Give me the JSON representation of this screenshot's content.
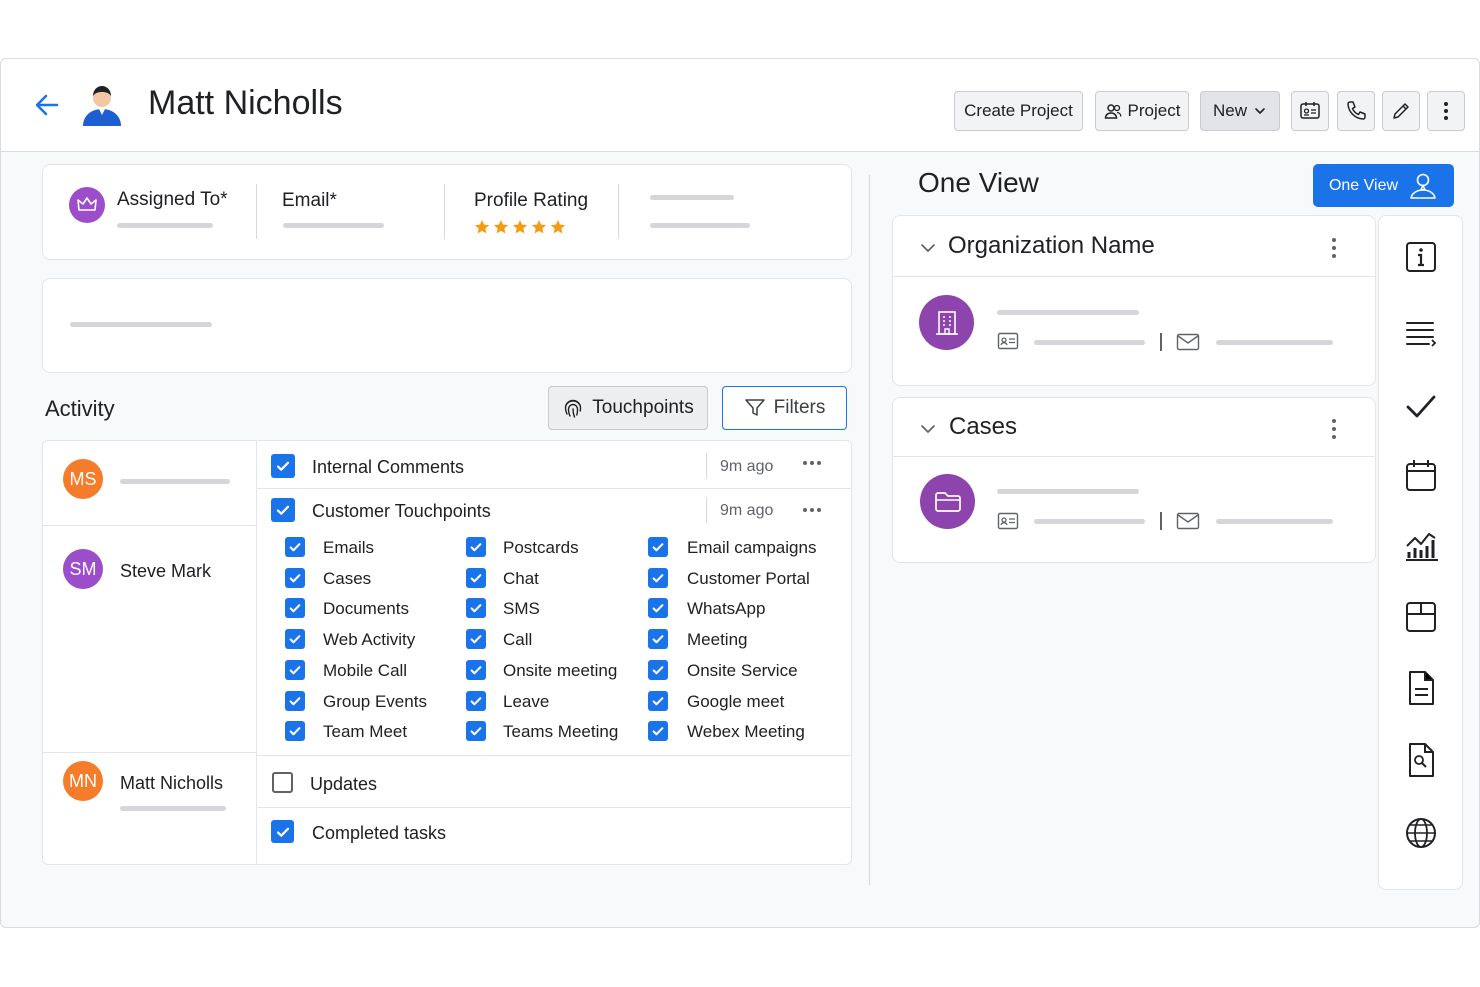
{
  "header": {
    "title": "Matt Nicholls",
    "back_icon": "arrow-left-icon",
    "user_icon": "user-avatar-icon",
    "buttons": {
      "create_project": "Create Project",
      "project": "Project",
      "new": "New"
    },
    "icon_buttons": [
      "id-card-icon",
      "phone-icon",
      "pencil-icon",
      "more-vertical-icon"
    ]
  },
  "summary": {
    "assigned_to_label": "Assigned To*",
    "email_label": "Email*",
    "profile_rating_label": "Profile Rating",
    "rating_stars": 5,
    "rating_max": 5
  },
  "activity": {
    "title": "Activity",
    "touchpoints_label": "Touchpoints",
    "filters_label": "Filters",
    "people": [
      {
        "initials": "MS",
        "name": "",
        "color": "#f57c2a"
      },
      {
        "initials": "SM",
        "name": "Steve Mark",
        "color": "#9b4dca"
      },
      {
        "initials": "MN",
        "name": "Matt Nicholls",
        "color": "#f57c2a"
      }
    ],
    "internal_comments": {
      "label": "Internal Comments",
      "time": "9m ago",
      "checked": true
    },
    "customer_touchpoints": {
      "label": "Customer Touchpoints",
      "time": "9m ago",
      "checked": true
    },
    "touchpoint_types": [
      [
        "Emails",
        "Postcards",
        "Email campaigns"
      ],
      [
        "Cases",
        "Chat",
        "Customer Portal"
      ],
      [
        "Documents",
        "SMS",
        "WhatsApp"
      ],
      [
        "Web Activity",
        "Call",
        "Meeting"
      ],
      [
        "Mobile Call",
        "Onsite meeting",
        "Onsite Service"
      ],
      [
        "Group Events",
        "Leave",
        "Google meet"
      ],
      [
        "Team Meet",
        "Teams Meeting",
        "Webex Meeting"
      ]
    ],
    "updates": {
      "label": "Updates",
      "checked": false
    },
    "completed_tasks": {
      "label": "Completed tasks",
      "checked": true
    }
  },
  "one_view": {
    "title": "One View",
    "button_label": "One View",
    "sections": [
      {
        "title": "Organization Name",
        "icon": "building-icon"
      },
      {
        "title": "Cases",
        "icon": "folder-icon"
      }
    ]
  },
  "side_rail": {
    "icons": [
      "info-icon",
      "list-icon",
      "check-icon",
      "calendar-icon",
      "analytics-icon",
      "box-icon",
      "document-icon",
      "file-search-icon",
      "globe-icon"
    ]
  },
  "colors": {
    "accent": "#1a73e8",
    "purple": "#8e44ad",
    "orange": "#f57c2a",
    "star": "#f39c12"
  }
}
